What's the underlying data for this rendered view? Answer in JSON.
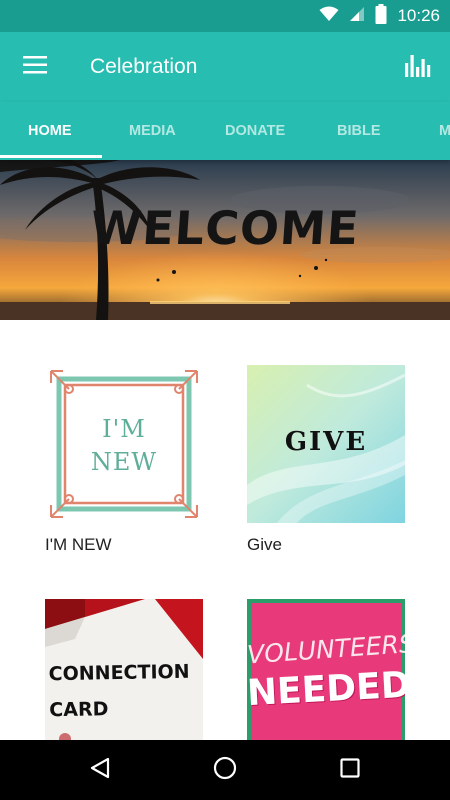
{
  "status_bar": {
    "time": "10:26",
    "icons": [
      "wifi-icon",
      "cell-signal-icon",
      "battery-icon"
    ],
    "background": "#1a9d91"
  },
  "app_bar": {
    "title": "Celebration",
    "background": "#27bdb0",
    "left_icon": "hamburger-menu-icon",
    "right_icon": "bar-chart-icon"
  },
  "tabs": [
    {
      "label": "HOME",
      "active": true
    },
    {
      "label": "MEDIA",
      "active": false
    },
    {
      "label": "DONATE",
      "active": false
    },
    {
      "label": "BIBLE",
      "active": false
    },
    {
      "label": "M",
      "active": false
    }
  ],
  "banner": {
    "text": "WELCOME",
    "description_colors": [
      "#ffb24a",
      "#1b1b1b"
    ]
  },
  "cards": [
    {
      "label": "I'M NEW",
      "image_text": [
        "I'M",
        "NEW"
      ],
      "accent": "#5fae9a"
    },
    {
      "label": "Give",
      "image_text": "GIVE"
    },
    {
      "label": "",
      "image_text": [
        "CONNECTION",
        "CARD"
      ]
    },
    {
      "label": "",
      "image_text": [
        "VOLUNTEERS",
        "NEEDED!"
      ]
    }
  ],
  "nav_bar": {
    "buttons": [
      "back-icon",
      "home-icon",
      "recents-icon"
    ]
  }
}
